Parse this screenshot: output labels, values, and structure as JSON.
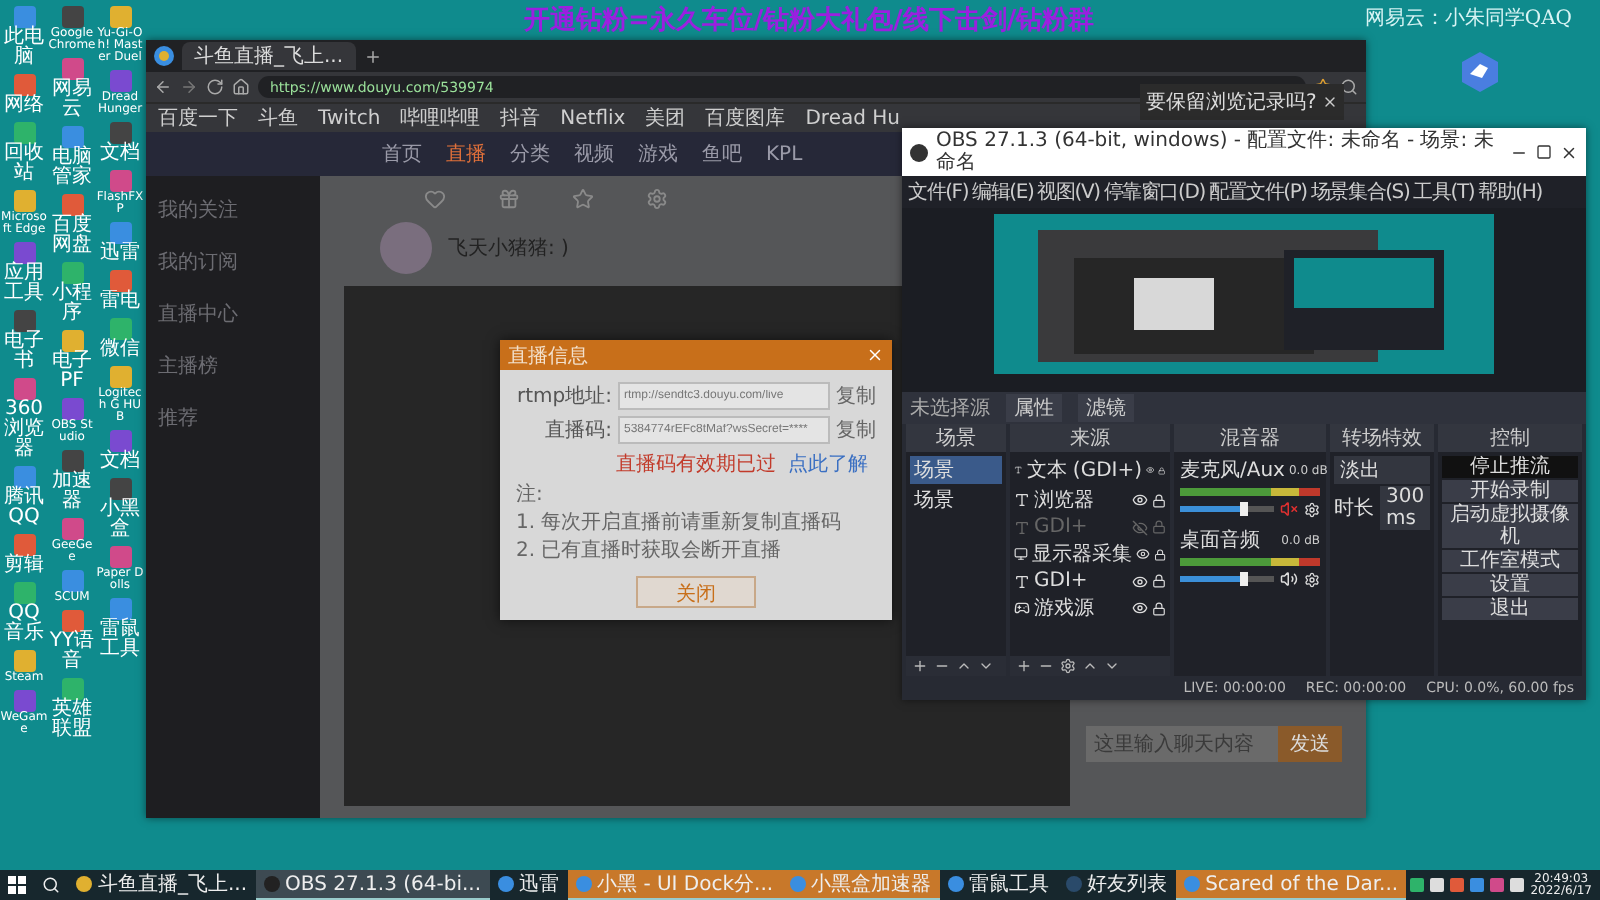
{
  "overlay": {
    "banner": "开通钻粉=永久车位/钻粉大礼包/线下击剑/钻粉群",
    "credit": "网易云：小朱同学QAQ"
  },
  "desktop_icons": [
    [
      "此电脑",
      "网络",
      "回收站",
      "Microsoft Edge",
      "应用工具",
      "电子书",
      "360浏览器",
      "腾讯QQ",
      "剪辑",
      "QQ音乐",
      "Steam",
      "WeGame"
    ],
    [
      "Google Chrome",
      "网易云",
      "电脑管家",
      "百度网盘",
      "小程序",
      "电子PF",
      "OBS Studio",
      "加速器",
      "GeeGee",
      "SCUM",
      "YY语音",
      "英雄联盟"
    ],
    [
      "Yu-Gi-Oh! Master Duel",
      "Dread Hunger",
      "文档",
      "FlashFXP",
      "迅雷",
      "雷电",
      "微信",
      "Logitech G HUB",
      "文档",
      "小黑盒",
      "Paper Dolls",
      "雷鼠工具"
    ]
  ],
  "browser": {
    "tab": "斗鱼直播_飞上...",
    "url": "https://www.douyu.com/539974",
    "bookmarks": [
      "百度一下",
      "斗鱼",
      "Twitch",
      "哔哩哔哩",
      "抖音",
      "Netflix",
      "美团",
      "百度图库",
      "Dread Hu"
    ],
    "nav": [
      {
        "label": "首页",
        "selected": false
      },
      {
        "label": "直播",
        "selected": true
      },
      {
        "label": "分类",
        "selected": false
      },
      {
        "label": "视频",
        "selected": false
      },
      {
        "label": "游戏",
        "selected": false
      },
      {
        "label": "鱼吧",
        "selected": false
      },
      {
        "label": "KPL",
        "selected": false
      }
    ],
    "sidebar": [
      "我的关注",
      "我的订阅",
      "直播中心",
      "主播榜",
      "推荐"
    ],
    "streamer": "飞天小猪猪: )",
    "chat_placeholder": "这里输入聊天内容",
    "send": "发送",
    "notice": "要保留浏览记录吗?"
  },
  "dialog": {
    "title": "直播信息",
    "fields": [
      {
        "label": "rtmp地址:",
        "value": "rtmp://sendtc3.douyu.com/live",
        "action": "复制"
      },
      {
        "label": "直播码:",
        "value": "5384774rEFc8tMaf?wsSecret=****",
        "action": "复制"
      }
    ],
    "warning": "直播码有效期已过",
    "link": "点此了解",
    "note": "注:",
    "tips": [
      "1. 每次开启直播前请重新复制直播码",
      "2. 已有直播时获取会断开直播"
    ],
    "button": "关闭"
  },
  "obs": {
    "title": "OBS 27.1.3 (64-bit, windows) - 配置文件: 未命名 - 场景: 未命名",
    "menu": [
      "文件(F)",
      "编辑(E)",
      "视图(V)",
      "停靠窗口(D)",
      "配置文件(P)",
      "场景集合(S)",
      "工具(T)",
      "帮助(H)"
    ],
    "source_bar": {
      "label": "未选择源",
      "buttons": [
        "属性",
        "滤镜"
      ]
    },
    "scenes": {
      "title": "场景",
      "items": [
        {
          "label": "场景",
          "selected": true
        },
        {
          "label": "场景",
          "selected": false
        }
      ]
    },
    "sources": {
      "title": "来源",
      "items": [
        {
          "label": "文本 (GDI+)",
          "visible": true,
          "kind": "text"
        },
        {
          "label": "浏览器",
          "visible": true,
          "kind": "text"
        },
        {
          "label": "GDI+",
          "visible": false,
          "kind": "text"
        },
        {
          "label": "显示器采集",
          "visible": true,
          "kind": "display"
        },
        {
          "label": "GDI+",
          "visible": true,
          "kind": "text"
        },
        {
          "label": "游戏源",
          "visible": true,
          "kind": "game"
        }
      ]
    },
    "mixer": {
      "title": "混音器",
      "channels": [
        {
          "name": "麦克风/Aux",
          "reading": "0.0 dB",
          "level": 0.72,
          "muted": true
        },
        {
          "name": "桌面音频",
          "reading": "0.0 dB",
          "level": 0.72,
          "muted": false
        }
      ]
    },
    "transitions": {
      "title": "转场特效",
      "effect": "淡出",
      "duration_label": "时长",
      "duration": "300 ms"
    },
    "controls": {
      "title": "控制",
      "buttons": [
        {
          "label": "停止推流",
          "selected": true
        },
        {
          "label": "开始录制",
          "selected": false
        },
        {
          "label": "启动虚拟摄像机",
          "selected": false
        },
        {
          "label": "工作室模式",
          "selected": false
        },
        {
          "label": "设置",
          "selected": false
        },
        {
          "label": "退出",
          "selected": false
        }
      ]
    },
    "status": [
      "LIVE: 00:00:00",
      "REC: 00:00:00",
      "CPU: 0.0%, 60.00 fps"
    ]
  },
  "taskbar": {
    "items": [
      {
        "label": "斗鱼直播_飞上...",
        "active": false,
        "flashing": false,
        "kind": "browser"
      },
      {
        "label": "OBS 27.1.3 (64-bi...",
        "active": true,
        "flashing": false,
        "kind": "obs"
      },
      {
        "label": "迅雷",
        "active": false,
        "flashing": false,
        "kind": "app"
      },
      {
        "label": "小黑 - UI Dock分...",
        "active": false,
        "flashing": true,
        "kind": "app"
      },
      {
        "label": "小黑盒加速器",
        "active": false,
        "flashing": true,
        "kind": "app"
      },
      {
        "label": "雷鼠工具",
        "active": false,
        "flashing": false,
        "kind": "app"
      },
      {
        "label": "好友列表",
        "active": false,
        "flashing": false,
        "kind": "steam"
      },
      {
        "label": "Scared of the Dar...",
        "active": false,
        "flashing": true,
        "kind": "app"
      }
    ],
    "time": "20:49:03",
    "date": "2022/6/17"
  }
}
